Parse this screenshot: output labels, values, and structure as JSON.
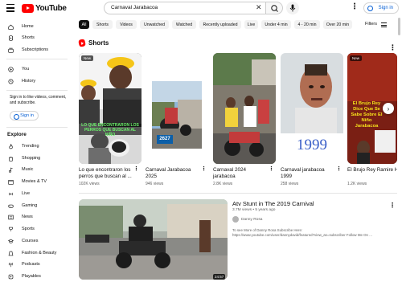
{
  "header": {
    "logo_text": "YouTube",
    "search_value": "Carnaval Jarabacoa",
    "sign_in": "Sign in"
  },
  "sidebar": {
    "main": [
      {
        "label": "Home",
        "icon": "home-icon"
      },
      {
        "label": "Shorts",
        "icon": "shorts-icon"
      },
      {
        "label": "Subscriptions",
        "icon": "subscriptions-icon"
      }
    ],
    "you": [
      {
        "label": "You",
        "icon": "you-icon"
      },
      {
        "label": "History",
        "icon": "history-icon"
      }
    ],
    "signin_note": "Sign in to like videos, comment, and subscribe.",
    "signin_button": "Sign in",
    "explore_heading": "Explore",
    "explore": [
      {
        "label": "Trending",
        "icon": "trending-icon"
      },
      {
        "label": "Shopping",
        "icon": "shopping-icon"
      },
      {
        "label": "Music",
        "icon": "music-icon"
      },
      {
        "label": "Movies & TV",
        "icon": "movies-icon"
      },
      {
        "label": "Live",
        "icon": "live-icon"
      },
      {
        "label": "Gaming",
        "icon": "gaming-icon"
      },
      {
        "label": "News",
        "icon": "news-icon"
      },
      {
        "label": "Sports",
        "icon": "sports-icon"
      },
      {
        "label": "Courses",
        "icon": "courses-icon"
      },
      {
        "label": "Fashion & Beauty",
        "icon": "fashion-icon"
      },
      {
        "label": "Podcasts",
        "icon": "podcasts-icon"
      },
      {
        "label": "Playables",
        "icon": "playables-icon"
      }
    ]
  },
  "chips": [
    "All",
    "Shorts",
    "Videos",
    "Unwatched",
    "Watched",
    "Recently uploaded",
    "Live",
    "Under 4 min",
    "4 - 20 min",
    "Over 20 min"
  ],
  "filters_label": "Filters",
  "shorts": {
    "heading": "Shorts",
    "items": [
      {
        "title": "Lo que encontraron los perros que buscan al ...",
        "views": "102K views",
        "badge": "New",
        "overlay": "LO QUE ENCONTRARON LOS PERROS QUE BUSCAN AL NIÑO"
      },
      {
        "title": "Carnaval Jarabacoa 2025",
        "views": "946 views",
        "badge": "",
        "plate": "2627"
      },
      {
        "title": "Carnaval 2024 jarabacoa",
        "views": "2.8K views",
        "badge": ""
      },
      {
        "title": "Carnaval jarabacoa 1999",
        "views": "258 views",
        "badge": "",
        "overlay": "1999"
      },
      {
        "title": "El Brujo Rey Ramire Habla Sobre El Niño",
        "views": "1.2K views",
        "badge": "New",
        "overlay": "El Brujo Rey Dice Que Se Sabe Sobre El Niño Jarabacoa"
      }
    ]
  },
  "video": {
    "title": "Atv Stunt in The 2019 Carnival",
    "meta": "3.7M views • 5 years ago",
    "channel": "Danny Rosa",
    "duration": "24:57",
    "desc_line1": "To see More of Danny Rosa Subscribe Here:",
    "desc_line2": "https://www.youtube.com/user/dannydavid/featured?view_as=subscriber Follow Me On ..."
  },
  "colors": {
    "brand_red": "#ff0000",
    "link_blue": "#065fd4",
    "text": "#0f0f0f",
    "secondary": "#606060",
    "chip_bg": "#f2f2f2"
  }
}
